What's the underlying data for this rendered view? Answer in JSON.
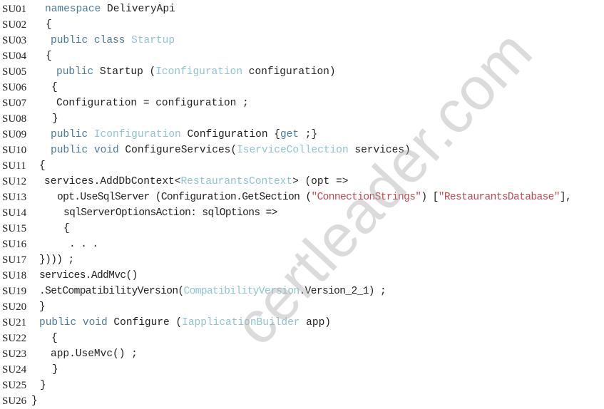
{
  "document": {
    "language": "C#",
    "lines": [
      {
        "number": "SU01",
        "tokens": [
          {
            "t": "namespace",
            "k": "kw"
          },
          {
            "t": " DeliveryApi",
            "k": "plain"
          }
        ]
      },
      {
        "number": "SU02",
        "tokens": [
          {
            "t": "{",
            "k": "plain"
          }
        ]
      },
      {
        "number": "SU03",
        "tokens": [
          {
            "t": "public class ",
            "k": "kw"
          },
          {
            "t": "Startup",
            "k": "type"
          }
        ]
      },
      {
        "number": "SU04",
        "tokens": [
          {
            "t": "{",
            "k": "plain"
          }
        ]
      },
      {
        "number": "SU05",
        "tokens": [
          {
            "t": "public",
            "k": "kw"
          },
          {
            "t": " Startup (",
            "k": "plain"
          },
          {
            "t": "Iconfiguration",
            "k": "type"
          },
          {
            "t": " configuration)",
            "k": "plain"
          }
        ]
      },
      {
        "number": "SU06",
        "tokens": [
          {
            "t": "{",
            "k": "plain"
          }
        ]
      },
      {
        "number": "SU07",
        "tokens": [
          {
            "t": "Configuration = configuration ;",
            "k": "plain"
          }
        ]
      },
      {
        "number": "SU08",
        "tokens": [
          {
            "t": "}",
            "k": "plain"
          }
        ]
      },
      {
        "number": "SU09",
        "tokens": [
          {
            "t": "public ",
            "k": "kw"
          },
          {
            "t": "Iconfiguration",
            "k": "type"
          },
          {
            "t": " Configuration {",
            "k": "plain"
          },
          {
            "t": "get",
            "k": "kw"
          },
          {
            "t": " ;}",
            "k": "plain"
          }
        ]
      },
      {
        "number": "SU10",
        "tokens": [
          {
            "t": "public void ",
            "k": "kw"
          },
          {
            "t": "ConfigureServices(",
            "k": "plain"
          },
          {
            "t": "IserviceCollection",
            "k": "type"
          },
          {
            "t": " services)",
            "k": "plain"
          }
        ]
      },
      {
        "number": "SU11",
        "tokens": [
          {
            "t": "{",
            "k": "plain"
          }
        ]
      },
      {
        "number": "SU12",
        "tokens": [
          {
            "t": "services.AddDbContext<",
            "k": "plain"
          },
          {
            "t": "RestaurantsContext",
            "k": "type"
          },
          {
            "t": "> (opt =>",
            "k": "plain"
          }
        ]
      },
      {
        "number": "SU13",
        "tokens": [
          {
            "t": "opt.UseSqlServer (Configuration.GetSection (",
            "k": "plain"
          },
          {
            "t": "\"ConnectionStrings\"",
            "k": "str"
          },
          {
            "t": ") [",
            "k": "plain"
          },
          {
            "t": "\"RestaurantsDatabase\"",
            "k": "str"
          },
          {
            "t": "],",
            "k": "plain"
          }
        ]
      },
      {
        "number": "SU14",
        "tokens": [
          {
            "t": "sqlServerOptionsAction: sqlOptions =>",
            "k": "plain"
          }
        ]
      },
      {
        "number": "SU15",
        "tokens": [
          {
            "t": "{",
            "k": "plain"
          }
        ]
      },
      {
        "number": "SU16",
        "tokens": [
          {
            "t": ". . .",
            "k": "plain"
          }
        ]
      },
      {
        "number": "SU17",
        "tokens": [
          {
            "t": "}))) ;",
            "k": "plain"
          }
        ]
      },
      {
        "number": "SU18",
        "tokens": [
          {
            "t": "services.AddMvc()",
            "k": "plain"
          }
        ]
      },
      {
        "number": "SU19",
        "tokens": [
          {
            "t": ".SetCompatibilityVersion(",
            "k": "plain"
          },
          {
            "t": "CompatibilityVersion",
            "k": "type"
          },
          {
            "t": ".Version_2_1) ;",
            "k": "plain"
          }
        ]
      },
      {
        "number": "SU20",
        "tokens": [
          {
            "t": "}",
            "k": "plain"
          }
        ]
      },
      {
        "number": "SU21",
        "tokens": [
          {
            "t": "public void ",
            "k": "kw"
          },
          {
            "t": "Configure (",
            "k": "plain"
          },
          {
            "t": "IapplicationBuilder",
            "k": "type"
          },
          {
            "t": " app)",
            "k": "plain"
          }
        ]
      },
      {
        "number": "SU22",
        "tokens": [
          {
            "t": "{",
            "k": "plain"
          }
        ]
      },
      {
        "number": "SU23",
        "tokens": [
          {
            "t": "app.UseMvc() ;",
            "k": "plain"
          }
        ]
      },
      {
        "number": "SU24",
        "tokens": [
          {
            "t": "}",
            "k": "plain"
          }
        ]
      },
      {
        "number": "SU25",
        "tokens": [
          {
            "t": "}",
            "k": "plain"
          }
        ]
      },
      {
        "number": "SU26",
        "tokens": [
          {
            "t": "}",
            "k": "plain"
          }
        ]
      }
    ]
  },
  "watermark": {
    "text": "certleader.com"
  },
  "colors": {
    "keyword": "#4a7a9b",
    "type": "#8ec3cf",
    "string": "#c2474f",
    "text": "#1f1f1f",
    "watermark": "#aaaaaa"
  }
}
